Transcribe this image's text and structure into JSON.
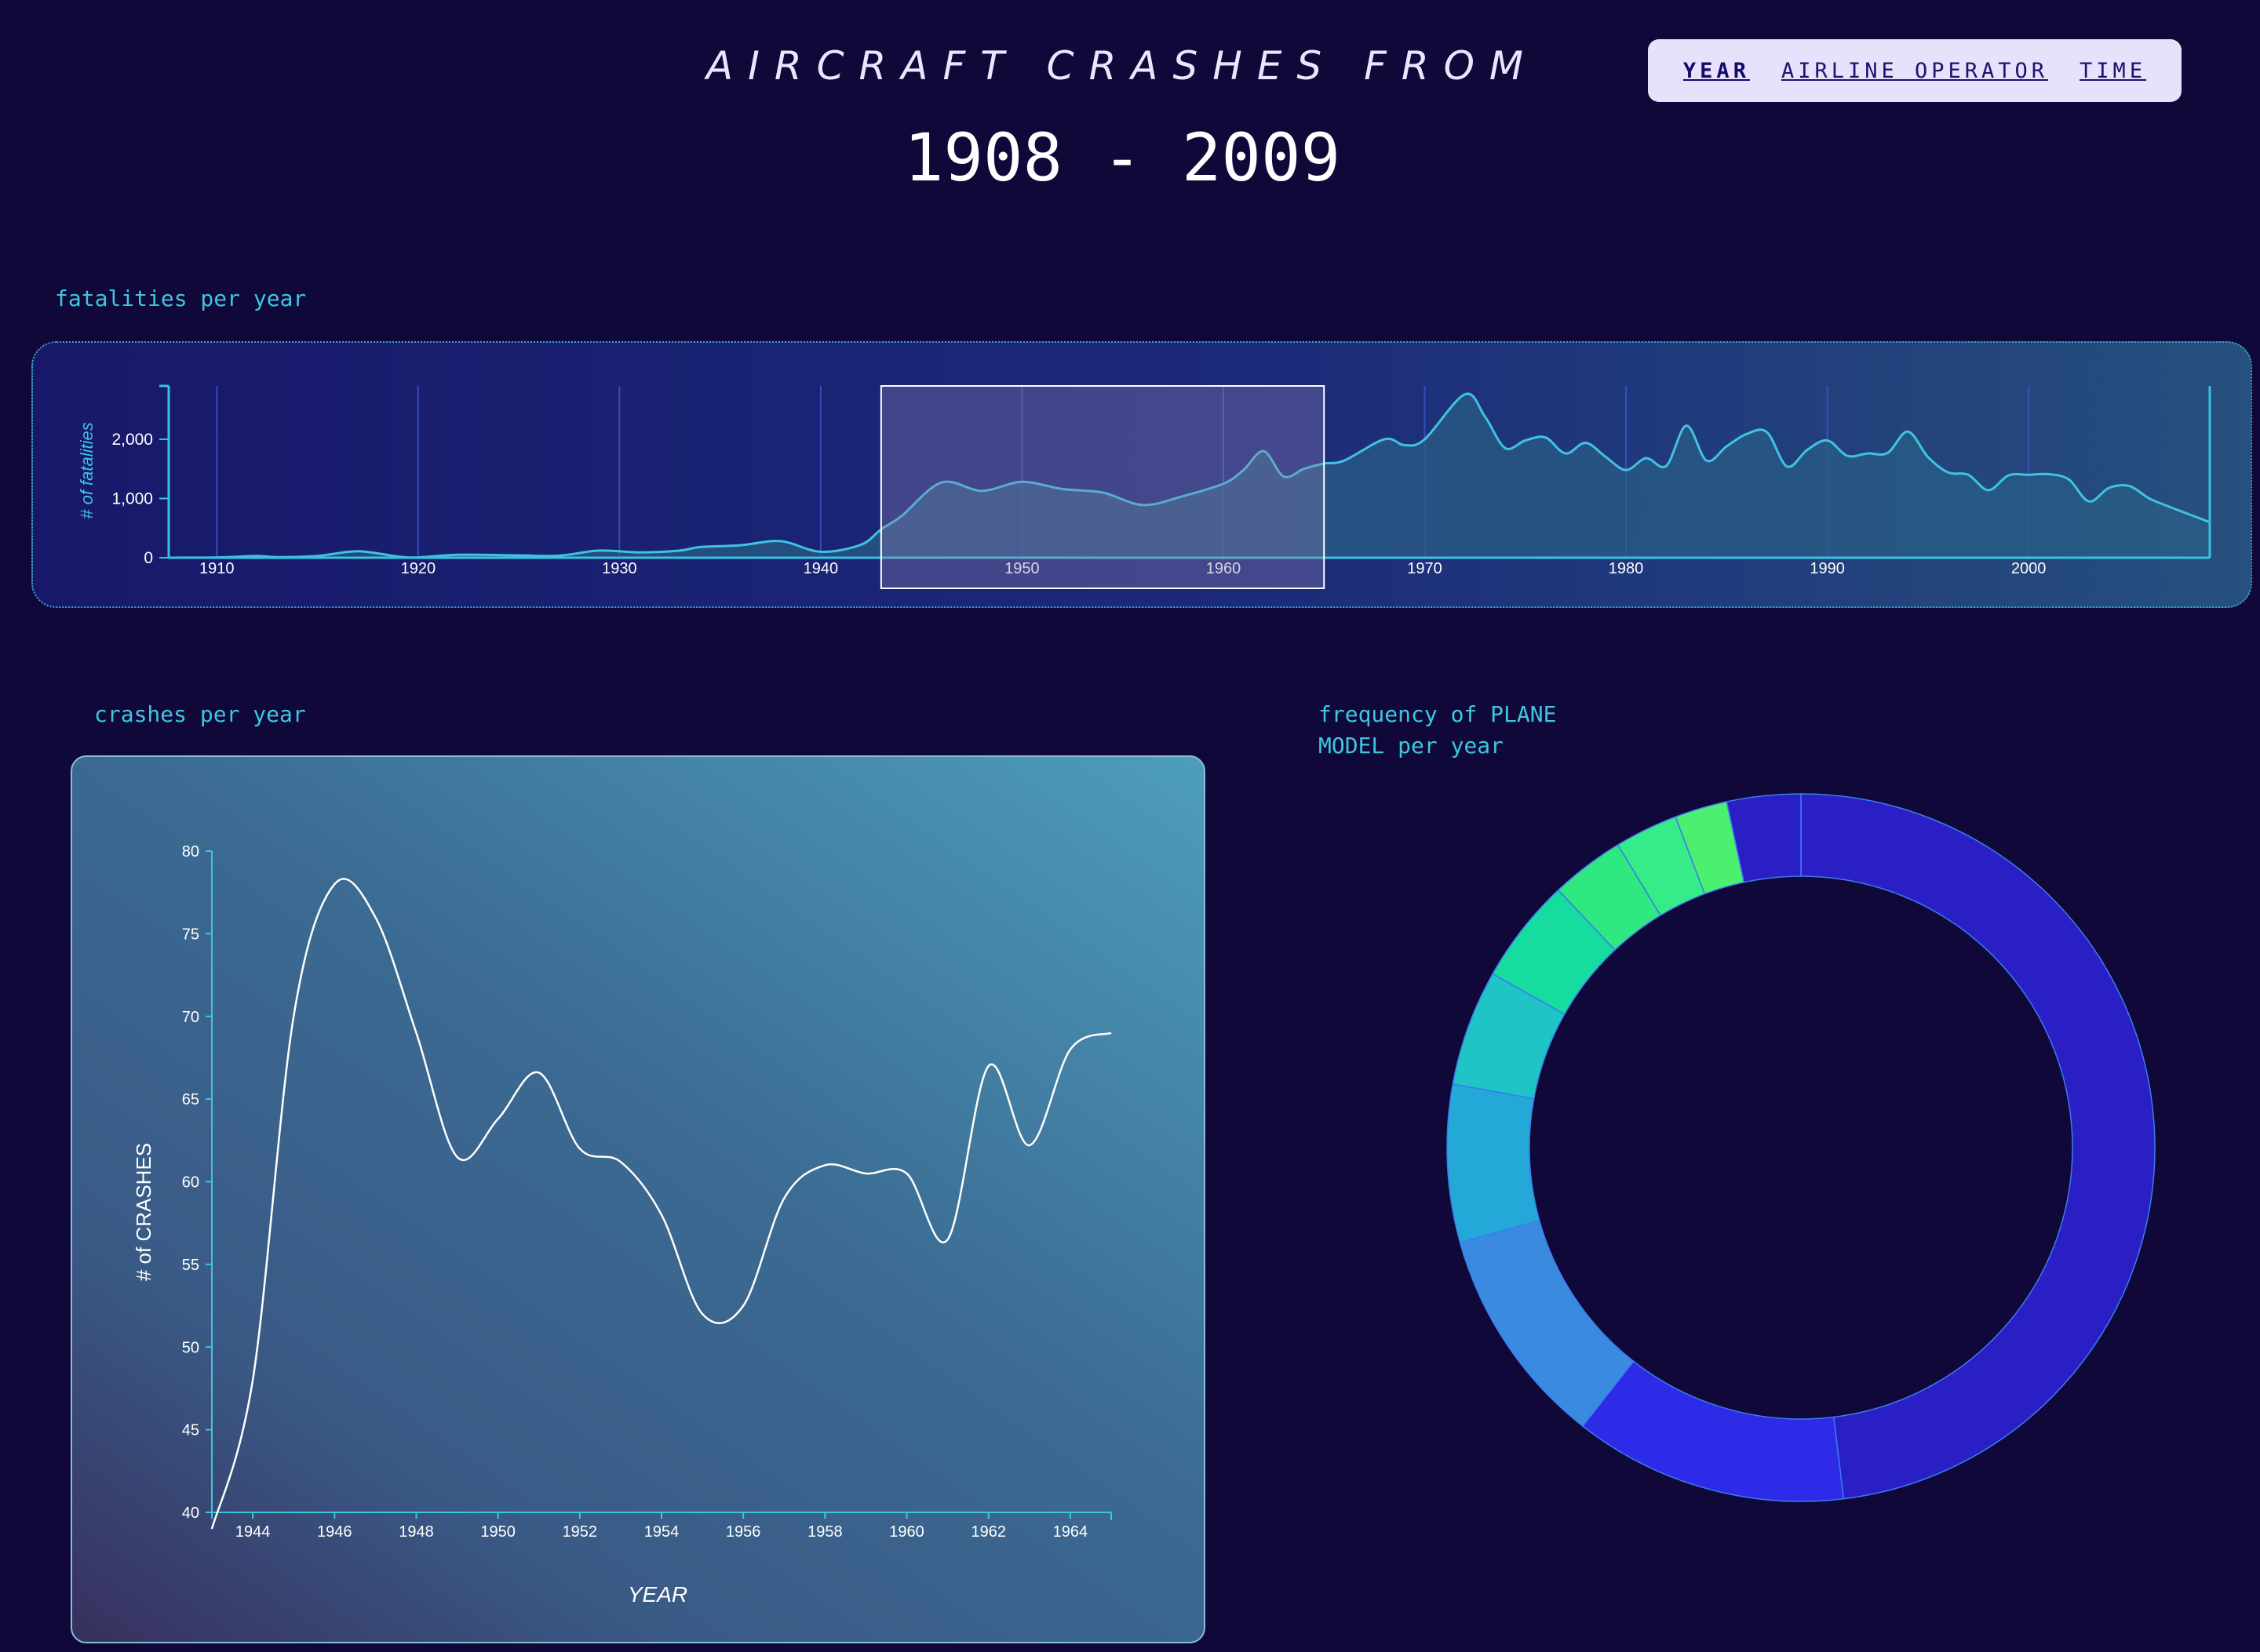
{
  "header": {
    "title_line1": "AIRCRAFT CRASHES FROM",
    "title_line2": "1908 - 2009"
  },
  "nav": {
    "items": [
      {
        "label": "YEAR",
        "active": true
      },
      {
        "label": "AIRLINE OPERATOR",
        "active": false
      },
      {
        "label": "TIME",
        "active": false
      }
    ]
  },
  "colors": {
    "background": "#0f0838",
    "accent": "#3ec6e0",
    "line_white": "#ffffff",
    "donut_slices": [
      "#2a1fc4",
      "#2d2ae8",
      "#3a8ae0",
      "#24a8d8",
      "#1fc4c4",
      "#16dca0",
      "#2ee880",
      "#36ec88",
      "#4cf070"
    ]
  },
  "sections": {
    "fatalities_label": "fatalities per year",
    "crashes_label": "crashes per year",
    "model_label_line1": "frequency of PLANE",
    "model_label_line2": "MODEL per year"
  },
  "chart_data": [
    {
      "type": "area",
      "title": "fatalities per year",
      "xlabel": "",
      "ylabel": "# of fatalities",
      "xlim": [
        1908,
        2009
      ],
      "ylim": [
        0,
        2900
      ],
      "x_ticks": [
        1910,
        1920,
        1930,
        1940,
        1950,
        1960,
        1970,
        1980,
        1990,
        2000
      ],
      "y_ticks": [
        0,
        1000,
        2000
      ],
      "y_tick_labels": [
        "0",
        "1,000",
        "2,000"
      ],
      "grid": "vertical",
      "brush_selection": [
        1943,
        1965
      ],
      "series": [
        {
          "x": [
            1908,
            1910,
            1912,
            1913,
            1915,
            1917,
            1919,
            1920,
            1922,
            1925,
            1927,
            1929,
            1931,
            1933,
            1934,
            1936,
            1938,
            1940,
            1942,
            1943,
            1944,
            1946,
            1948,
            1950,
            1952,
            1954,
            1956,
            1958,
            1960,
            1961,
            1962,
            1963,
            1964,
            1965,
            1966,
            1968,
            1969,
            1970,
            1972,
            1973,
            1974,
            1975,
            1976,
            1977,
            1978,
            1979,
            1980,
            1981,
            1982,
            1983,
            1984,
            1985,
            1986,
            1987,
            1988,
            1989,
            1990,
            1991,
            1992,
            1993,
            1994,
            1995,
            1996,
            1997,
            1998,
            1999,
            2000,
            2001,
            2002,
            2003,
            2004,
            2005,
            2006,
            2007,
            2009
          ],
          "values": [
            1,
            5,
            30,
            10,
            30,
            110,
            20,
            5,
            50,
            40,
            35,
            120,
            90,
            120,
            180,
            210,
            280,
            100,
            220,
            480,
            700,
            1270,
            1130,
            1280,
            1160,
            1100,
            890,
            1040,
            1250,
            1480,
            1800,
            1370,
            1500,
            1590,
            1640,
            2000,
            1900,
            2000,
            2760,
            2380,
            1850,
            1980,
            2030,
            1760,
            1940,
            1700,
            1480,
            1680,
            1550,
            2230,
            1640,
            1880,
            2090,
            2120,
            1540,
            1820,
            1980,
            1720,
            1760,
            1770,
            2130,
            1700,
            1440,
            1400,
            1140,
            1390,
            1400,
            1410,
            1320,
            950,
            1180,
            1210,
            1000,
            860,
            600
          ]
        }
      ]
    },
    {
      "type": "line",
      "title": "crashes per year",
      "xlabel": "YEAR",
      "ylabel": "# of CRASHES",
      "xlim": [
        1943,
        1965
      ],
      "ylim": [
        40,
        80
      ],
      "x_ticks": [
        1944,
        1946,
        1948,
        1950,
        1952,
        1954,
        1956,
        1958,
        1960,
        1962,
        1964
      ],
      "y_ticks": [
        40,
        45,
        50,
        55,
        60,
        65,
        70,
        75,
        80
      ],
      "series": [
        {
          "x": [
            1943,
            1944,
            1945,
            1946,
            1947,
            1948,
            1949,
            1950,
            1951,
            1952,
            1953,
            1954,
            1955,
            1956,
            1957,
            1958,
            1959,
            1960,
            1961,
            1962,
            1963,
            1964,
            1965
          ],
          "values": [
            39,
            48,
            70,
            78,
            76,
            69,
            61.5,
            63.8,
            66.6,
            62,
            61.2,
            58,
            52,
            52.5,
            59,
            61,
            60.5,
            60.5,
            56.5,
            67,
            62.2,
            68,
            69
          ]
        }
      ]
    },
    {
      "type": "pie",
      "title": "frequency of PLANE MODEL per year",
      "donut": true,
      "series": [
        {
          "values": [
            50,
            13,
            10.5,
            7.5,
            5.5,
            5,
            3.5,
            3,
            2.5,
            3.5
          ]
        }
      ]
    }
  ]
}
